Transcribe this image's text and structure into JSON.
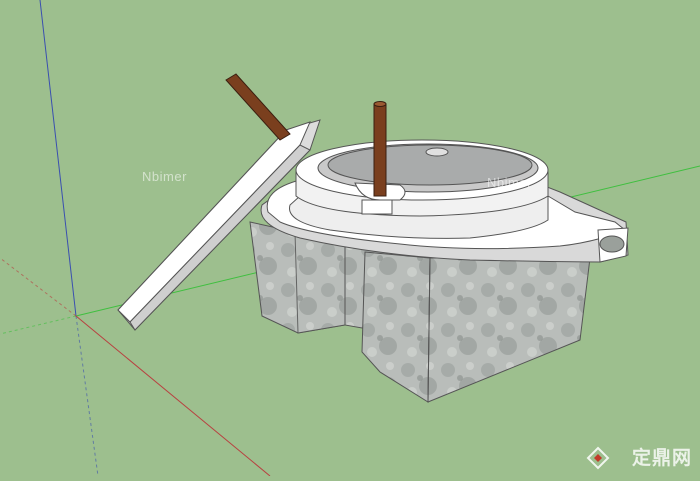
{
  "scene": {
    "background": "#9dbf8e",
    "subject": "stone mill",
    "colors": {
      "stone": "#b7bbb8",
      "top_face": "#ffffff",
      "handle": "#7a3f1e",
      "axis_red": "#b84040",
      "axis_green": "#3fbf3f",
      "axis_blue": "#3a4fb0"
    }
  },
  "watermarks": {
    "left": "Nbimer",
    "right": "Nbimer"
  },
  "brand": {
    "icon": "diamond-logo-icon",
    "text": "定鼎网"
  }
}
